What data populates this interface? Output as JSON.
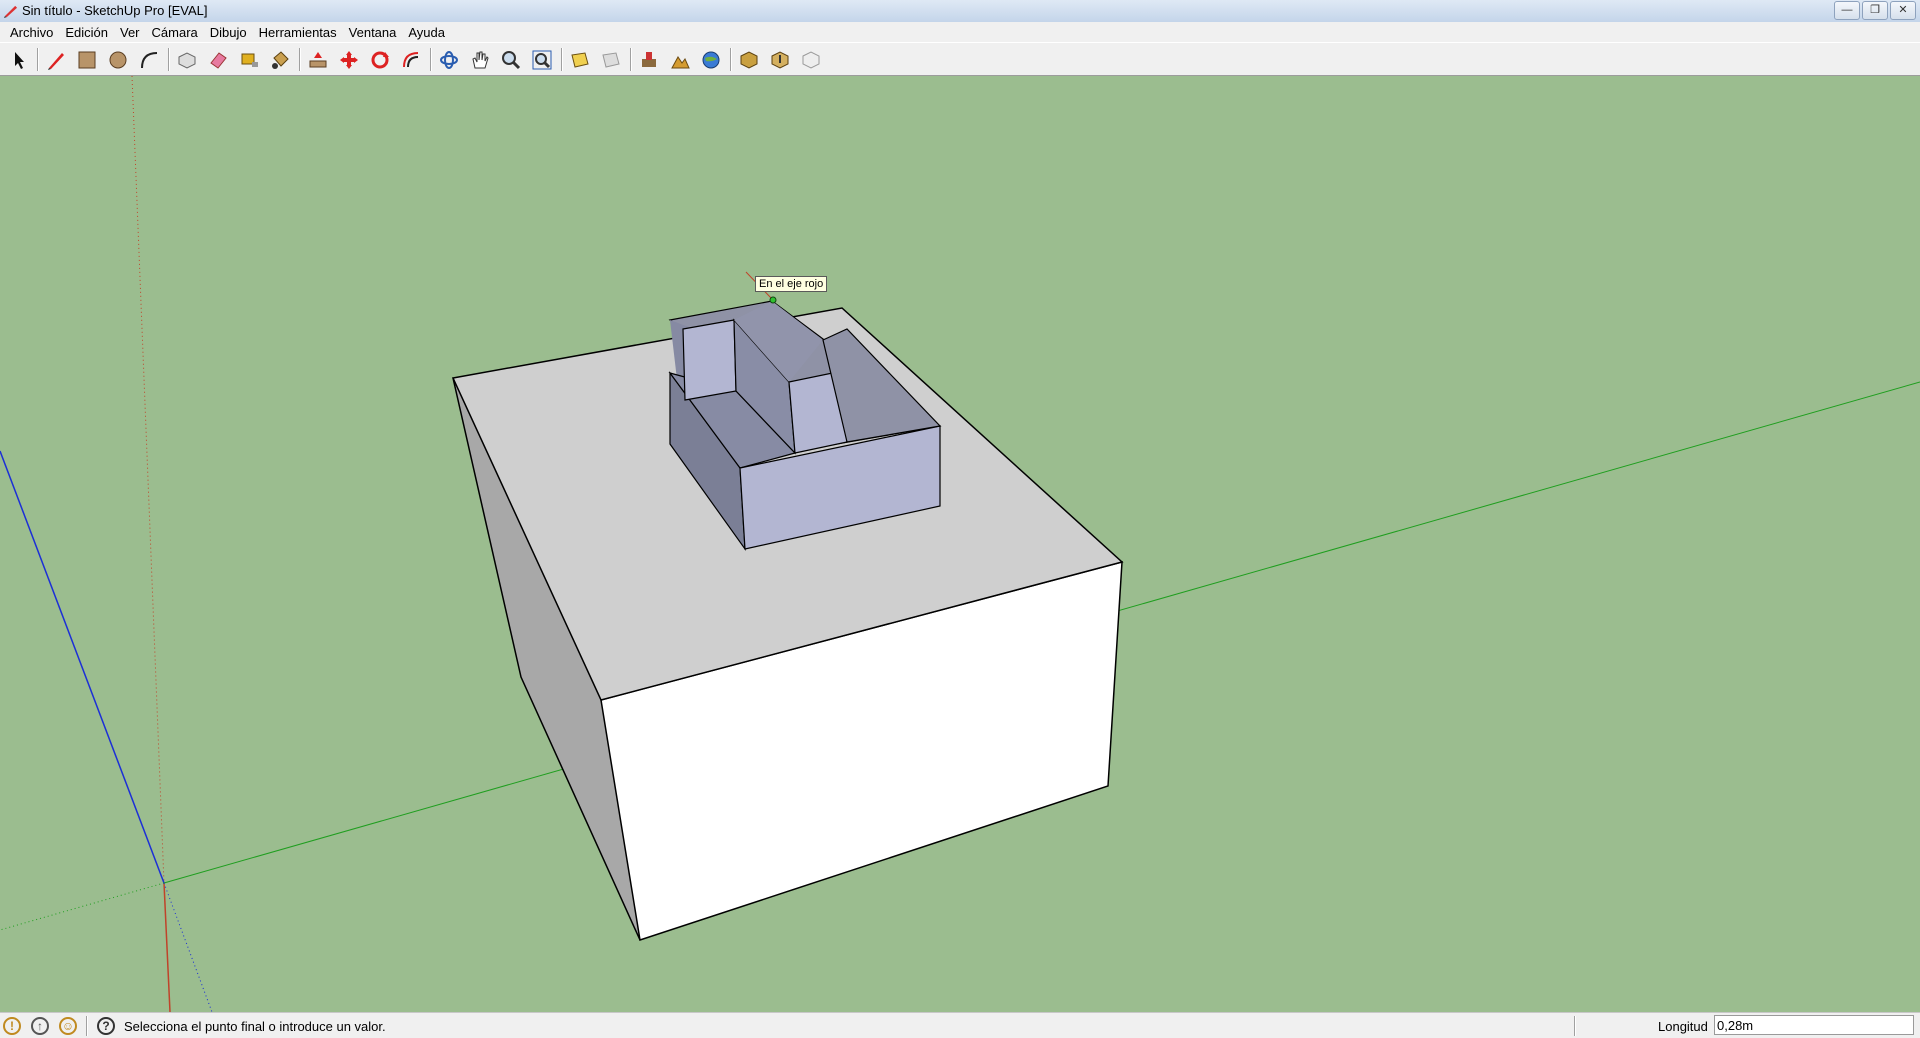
{
  "window": {
    "title": "Sin título - SketchUp Pro [EVAL]",
    "background_title": "",
    "controls": [
      "minimize",
      "maximize",
      "close"
    ]
  },
  "menu": [
    "Archivo",
    "Edición",
    "Ver",
    "Cámara",
    "Dibujo",
    "Herramientas",
    "Ventana",
    "Ayuda"
  ],
  "toolbar": {
    "tools": [
      "select",
      "line",
      "rectangle",
      "circle",
      "arc",
      "make-component",
      "eraser",
      "tape-measure",
      "paint-bucket",
      "push-pull",
      "move",
      "rotate",
      "offset",
      "orbit",
      "pan",
      "zoom",
      "zoom-extents",
      "previous-view",
      "next-view",
      "add-location",
      "toggle-terrain",
      "google-earth",
      "get-models",
      "share-model",
      "share-component"
    ]
  },
  "viewport": {
    "tooltip": "En el eje rojo",
    "background_color": "#9bbd8f"
  },
  "status": {
    "message": "Selecciona el punto final o introduce un valor.",
    "measure_label": "Longitud",
    "measure_value": "0,28m"
  }
}
